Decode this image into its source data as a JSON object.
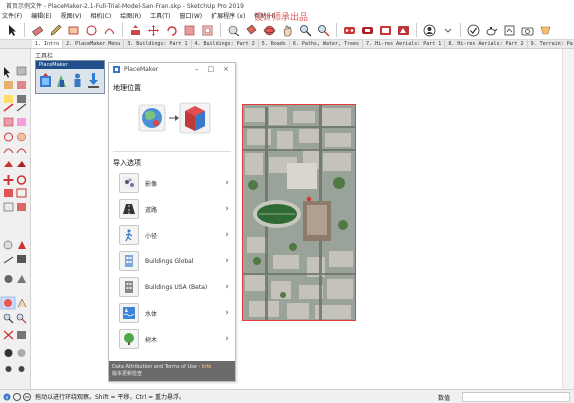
{
  "window": {
    "title": "首页示例文件 - PlaceMaker-2.1-Full-Trial-Model-San-Fran.skp - SketchUp Pro 2019",
    "watermark": "设计师承出品"
  },
  "menu": [
    "文件(F)",
    "编辑(E)",
    "视图(V)",
    "相机(C)",
    "绘图(R)",
    "工具(T)",
    "窗口(W)",
    "扩展程序 (x)",
    "帮助(H)"
  ],
  "toolbar_icons": [
    "select-icon",
    "eraser-icon",
    "pencil-icon",
    "rectangle-icon",
    "circle-icon",
    "arc-icon",
    "push-pull-icon",
    "move-icon",
    "rotate-icon",
    "scale-icon",
    "offset-icon",
    "tape-measure-icon",
    "paint-bucket-icon",
    "orbit-icon",
    "pan-icon",
    "zoom-icon",
    "zoom-extents-icon",
    "warehouse-icon",
    "extension-icon",
    "layout-icon",
    "user-icon",
    "check-icon",
    "teapot-icon",
    "style-icon",
    "section-icon",
    "camera-icon"
  ],
  "scene_tabs": [
    "1. Intro",
    "2. PlaceMaker Menu",
    "3. Buildings: Part 1",
    "4. Buildings: Part 2",
    "5. Roads",
    "6. Paths, Water, Trees",
    "7. Hi-res Aerials: Part 1",
    "8. Hi-res Aerials: Part 2",
    "9. Terrain: Pa"
  ],
  "active_scene_index": 0,
  "floating_toolbar": {
    "label": "工具栏",
    "title": "PlaceMaker"
  },
  "placemaker": {
    "title": "PlaceMaker",
    "section_location": "地理位置",
    "section_import": "导入选项",
    "options": [
      {
        "label": "影像",
        "icon": "imagery-icon"
      },
      {
        "label": "道路",
        "icon": "roads-icon"
      },
      {
        "label": "小径",
        "icon": "paths-icon"
      },
      {
        "label": "Buildings Global",
        "icon": "buildings-global-icon"
      },
      {
        "label": "Buildings USA (Beta)",
        "icon": "buildings-usa-icon"
      },
      {
        "label": "水体",
        "icon": "water-icon"
      },
      {
        "label": "树木",
        "icon": "trees-icon"
      }
    ],
    "footer_text": "Data Attribution and Terms of Use - ",
    "footer_link": "Info",
    "footer_text2": "版本更新检查"
  },
  "status": {
    "hint": "拖动以进行环绕观察。Shift = 平移，Ctrl = 重力悬浮。",
    "measure_label": "数值",
    "measure_value": ""
  },
  "colors": {
    "accent_red": "#e53c3c",
    "pm_title_blue": "#1f4e8a",
    "footer_gray": "#6b6b6b"
  }
}
